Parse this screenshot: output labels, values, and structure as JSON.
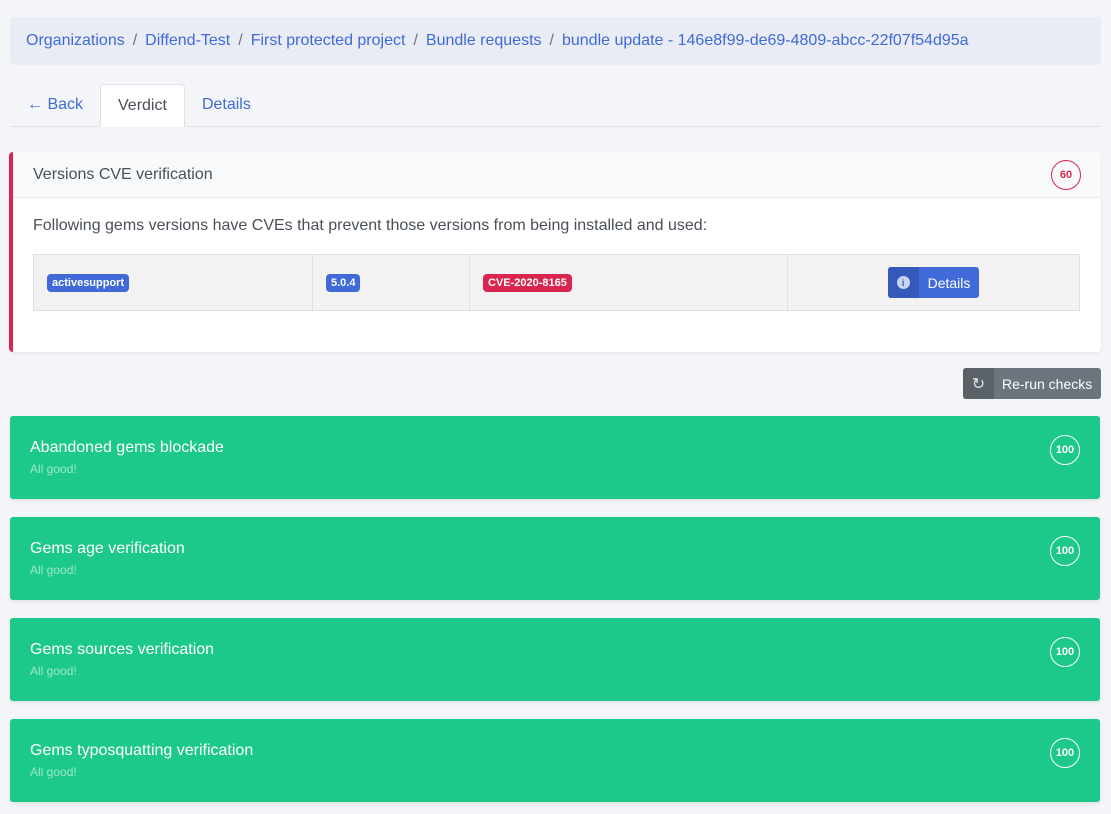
{
  "breadcrumb": [
    {
      "label": "Organizations"
    },
    {
      "label": "Diffend-Test"
    },
    {
      "label": "First protected project"
    },
    {
      "label": "Bundle requests"
    },
    {
      "label": "bundle update - 146e8f99-de69-4809-abcc-22f07f54d95a"
    }
  ],
  "breadcrumb_separator": "/",
  "tabs": {
    "back": "← Back",
    "verdict": "Verdict",
    "details": "Details"
  },
  "cve_card": {
    "title": "Versions CVE verification",
    "score": "60",
    "description": "Following gems versions have CVEs that prevent those versions from being installed and used:",
    "rows": [
      {
        "gem": "activesupport",
        "version": "5.0.4",
        "cve": "CVE-2020-8165",
        "button": "Details"
      }
    ]
  },
  "rerun_button": "Re-run checks",
  "checks": [
    {
      "title": "Abandoned gems blockade",
      "status": "All good!",
      "score": "100"
    },
    {
      "title": "Gems age verification",
      "status": "All good!",
      "score": "100"
    },
    {
      "title": "Gems sources verification",
      "status": "All good!",
      "score": "100"
    },
    {
      "title": "Gems typosquatting verification",
      "status": "All good!",
      "score": "100"
    }
  ],
  "colors": {
    "primary": "#3f6ad8",
    "danger": "#d92550",
    "success": "#1dc98a",
    "secondary": "#6c757d"
  },
  "icons": {
    "details": "info-icon",
    "rerun": "refresh-icon"
  }
}
